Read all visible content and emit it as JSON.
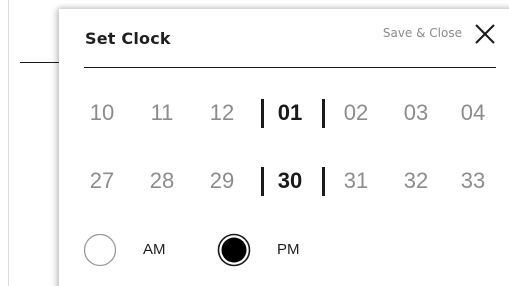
{
  "dialog": {
    "title": "Set Clock",
    "save_close_label": "Save & Close"
  },
  "hours": {
    "values": [
      "10",
      "11",
      "12",
      "01",
      "02",
      "03",
      "04"
    ],
    "selected": "01"
  },
  "minutes": {
    "values": [
      "27",
      "28",
      "29",
      "30",
      "31",
      "32",
      "33"
    ],
    "selected": "30"
  },
  "period": {
    "options": [
      {
        "label": "AM",
        "selected": false
      },
      {
        "label": "PM",
        "selected": true
      }
    ]
  },
  "icons": {
    "close": "close-icon",
    "radio": "radio-icon"
  },
  "colors": {
    "selected_text": "#1a1a1a",
    "unselected_text": "#8c8c8c",
    "secondary_text": "#8a8a8a"
  }
}
